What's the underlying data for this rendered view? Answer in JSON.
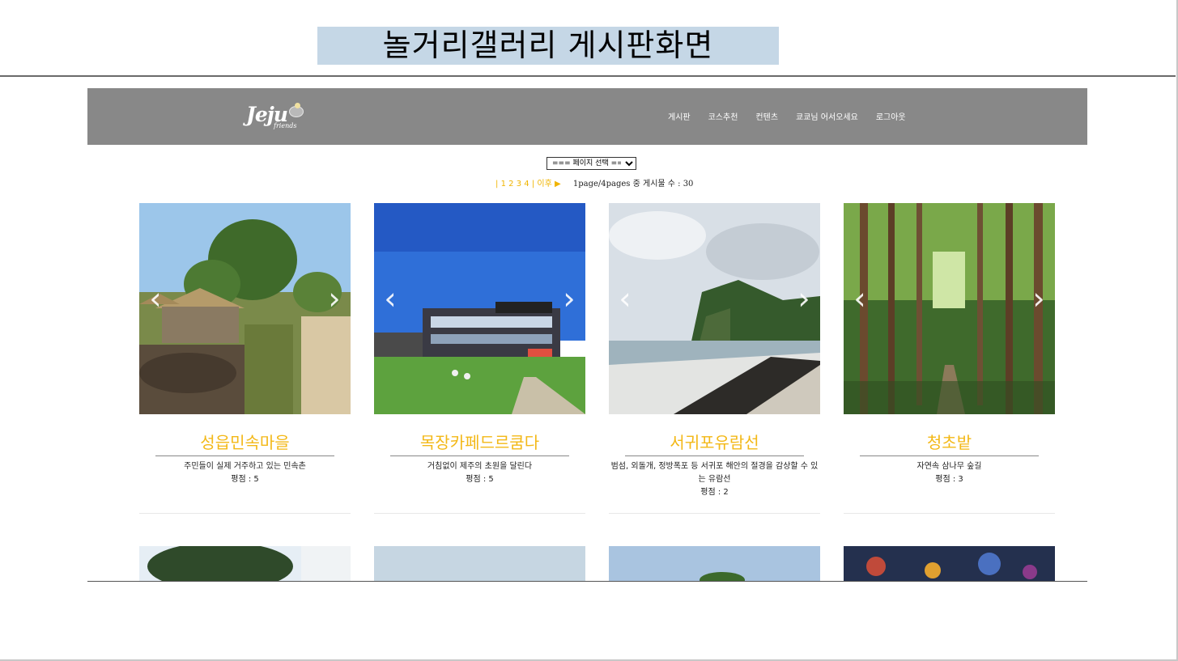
{
  "slide": {
    "title": "놀거리갤러리 게시판화면"
  },
  "header": {
    "logo_text": "Jeju",
    "logo_sub": "friends",
    "nav": [
      "게시판",
      "코스추천",
      "컨텐츠",
      "쿄쿄님 어서오세요",
      "로그아웃"
    ]
  },
  "toolbar": {
    "page_select": "=== 페이지 선택 ===",
    "pager": {
      "sep": "|",
      "pages": [
        "1",
        "2",
        "3",
        "4"
      ],
      "next": "이후 ▶",
      "info": "1page/4pages 중 게시물 수 : 30"
    }
  },
  "cards": [
    {
      "title": "성읍민속마을",
      "desc": "주민들이 실제 거주하고 있는 민속촌",
      "rating": "평점 : 5"
    },
    {
      "title": "목장카페드르쿰다",
      "desc": "거침없이 제주의 초원을 달린다",
      "rating": "평점 : 5"
    },
    {
      "title": "서귀포유람선",
      "desc": "범섬, 외돌개, 정방폭포 등 서귀포 해안의 절경을 감상할 수 있는 유람선",
      "rating": "평점 : 2"
    },
    {
      "title": "청초밭",
      "desc": "자연속 삼나무 숲길",
      "rating": "평점 : 3"
    }
  ],
  "carousel": {
    "prev": "‹",
    "next": "›"
  },
  "colors": {
    "navbar": "#888888",
    "accent": "#f3b817",
    "title_bg": "#c5d7e6"
  }
}
